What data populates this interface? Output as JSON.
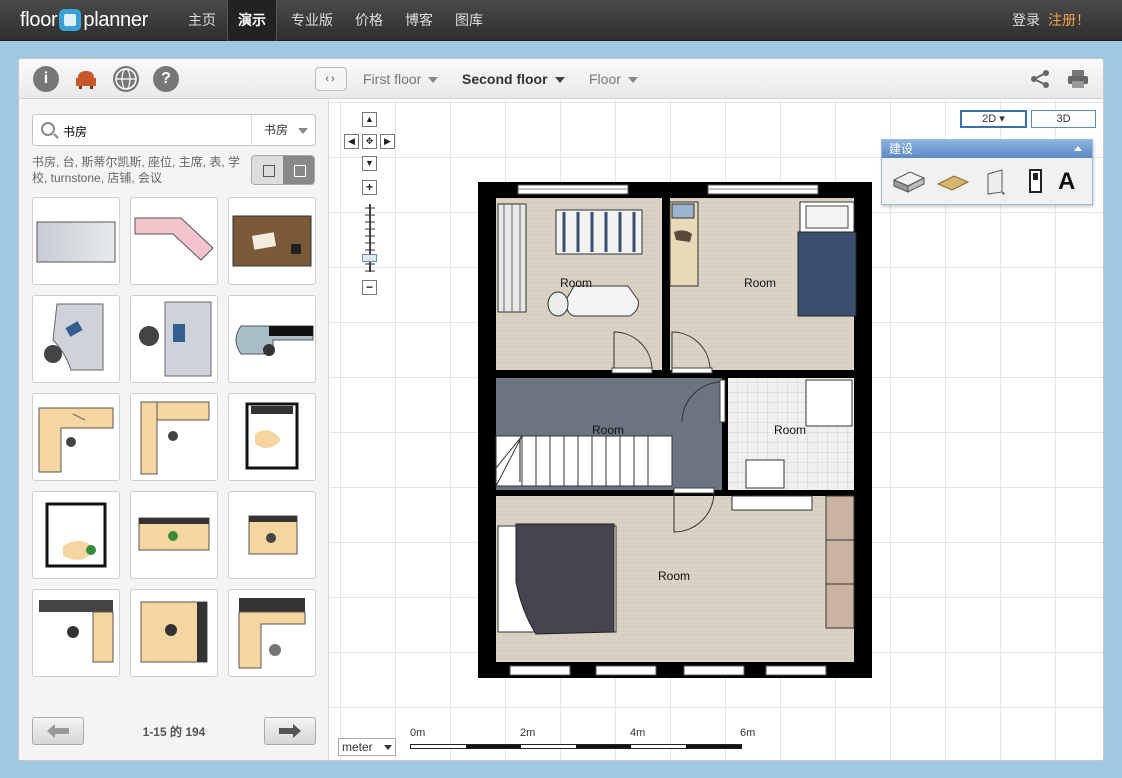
{
  "nav": {
    "logo_left": "floor",
    "logo_right": "planner",
    "items": [
      {
        "label": "主页"
      },
      {
        "label": "演示"
      },
      {
        "label": "专业版"
      },
      {
        "label": "价格"
      },
      {
        "label": "博客"
      },
      {
        "label": "图库"
      }
    ],
    "active_index": 1,
    "login": "登录",
    "register": "注册！"
  },
  "toolbar": {
    "icons": [
      "info-icon",
      "armchair-icon",
      "globe-icon",
      "help-icon",
      "share-icon",
      "print-icon"
    ],
    "nav_arrows": "‹›",
    "floors": [
      {
        "label": "First floor"
      },
      {
        "label": "Second floor"
      },
      {
        "label": "Floor"
      }
    ],
    "active_floor": 1
  },
  "sidebar": {
    "search_value": "书房",
    "search_category": "书房",
    "tags_text": "书房, 台, 斯蒂尔凯斯, 座位, 主席, 表, 学校, turnstone, 店铺, 会议",
    "pagination": "1-15 的 194"
  },
  "canvas": {
    "view_modes": [
      "2D",
      "3D"
    ],
    "active_view": "2D",
    "build_panel_title": "建设",
    "build_tools": [
      "wall-icon",
      "floor-surface-icon",
      "door-icon",
      "window-icon",
      "text-tool-icon"
    ],
    "text_tool_glyph": "A",
    "unit": "meter",
    "scale_labels": [
      "0m",
      "2m",
      "4m",
      "6m"
    ],
    "rooms": [
      "Room",
      "Room",
      "Room",
      "Room",
      "Room"
    ]
  },
  "colors": {
    "nav_bg": "#333333",
    "register": "#f2a24a",
    "accent_blue": "#5a89c4",
    "wall": "#000000",
    "floor_beige": "#d8d0c2",
    "hall_grey": "#6b7480",
    "bed_blue": "#3c4e6e",
    "bed_dark": "#45454f"
  }
}
